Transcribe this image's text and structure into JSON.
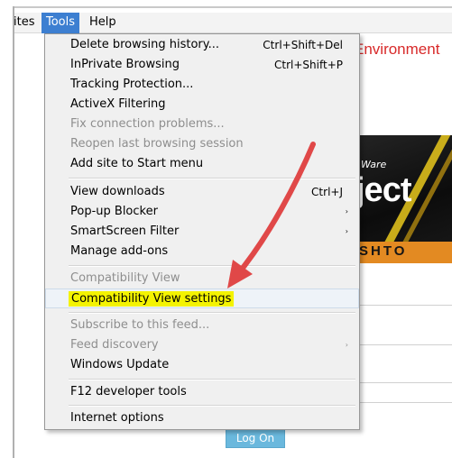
{
  "menubar": {
    "items": [
      {
        "label": "ites"
      },
      {
        "label": "Tools"
      },
      {
        "label": "Help"
      }
    ]
  },
  "page": {
    "title": "Environment",
    "banner_small": "Ware",
    "banner_brand": "ject",
    "banner_org": "SHTO",
    "login_label": "Log On"
  },
  "tools_menu": {
    "items": [
      {
        "label": "Delete browsing history...",
        "shortcut": "Ctrl+Shift+Del",
        "state": "enabled"
      },
      {
        "label": "InPrivate Browsing",
        "shortcut": "Ctrl+Shift+P",
        "state": "enabled"
      },
      {
        "label": "Tracking Protection...",
        "state": "enabled"
      },
      {
        "label": "ActiveX Filtering",
        "state": "enabled"
      },
      {
        "label": "Fix connection problems...",
        "state": "disabled"
      },
      {
        "label": "Reopen last browsing session",
        "state": "disabled"
      },
      {
        "label": "Add site to Start menu",
        "state": "enabled"
      },
      {
        "label": "View downloads",
        "shortcut": "Ctrl+J",
        "state": "enabled"
      },
      {
        "label": "Pop-up Blocker",
        "submenu": "›",
        "state": "enabled"
      },
      {
        "label": "SmartScreen Filter",
        "submenu": "›",
        "state": "enabled"
      },
      {
        "label": "Manage add-ons",
        "state": "enabled"
      },
      {
        "label": "Compatibility View",
        "state": "disabled"
      },
      {
        "label": "Compatibility View settings",
        "state": "highlighted"
      },
      {
        "label": "Subscribe to this feed...",
        "state": "disabled"
      },
      {
        "label": "Feed discovery",
        "submenu": "›",
        "state": "disabled"
      },
      {
        "label": "Windows Update",
        "state": "enabled"
      },
      {
        "label": "F12 developer tools",
        "state": "enabled"
      },
      {
        "label": "Internet options",
        "state": "enabled"
      }
    ]
  },
  "annotation": {
    "type": "arrow",
    "color": "#e04848",
    "points_to": "Compatibility View settings",
    "highlight_color": "#f4f300"
  },
  "colors": {
    "menu_active": "#3d7fd1",
    "title_red": "#d82a2a",
    "login_button": "#6ab8dd"
  }
}
